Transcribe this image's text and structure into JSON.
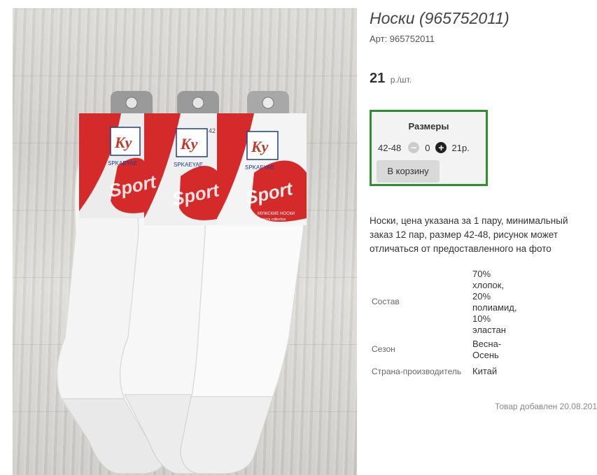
{
  "product": {
    "title": "Носки (965752011)",
    "sku": "Арт: 965752011",
    "price": "21",
    "price_unit": "р./шт.",
    "image_alt": "Белые мужские носки Ky Sport, 3 пары"
  },
  "packaging": {
    "brand": "Ky",
    "company": "SPKAEYAE",
    "sport": "Sport",
    "line1": "МУЖСКИЕ НОСКИ",
    "line2": "men's collection",
    "size_mark": "42"
  },
  "sizes": {
    "heading": "Размеры",
    "size": "42-48",
    "quantity": "0",
    "price": "21р.",
    "cart_button": "В корзину",
    "minus_symbol": "−",
    "plus_symbol": "+"
  },
  "description": "Носки, цена указана за 1 пару, минимальный заказ 12 пар, размер 42-48, рисунок может отличаться от предоставленного на фото",
  "specs": [
    {
      "label": "Состав",
      "lines": [
        "70%",
        "хлопок,",
        "20%",
        "полиамид,",
        "10%",
        "эластан"
      ]
    },
    {
      "label": "Сезон",
      "lines": [
        "Весна-",
        "Осень"
      ]
    },
    {
      "label": "Страна-производитель",
      "lines": [
        "Китай"
      ]
    }
  ],
  "added": "Товар добавлен 20.08.201",
  "colors": {
    "accent_border": "#2f8f2f",
    "card_red": "#d42a2a"
  }
}
